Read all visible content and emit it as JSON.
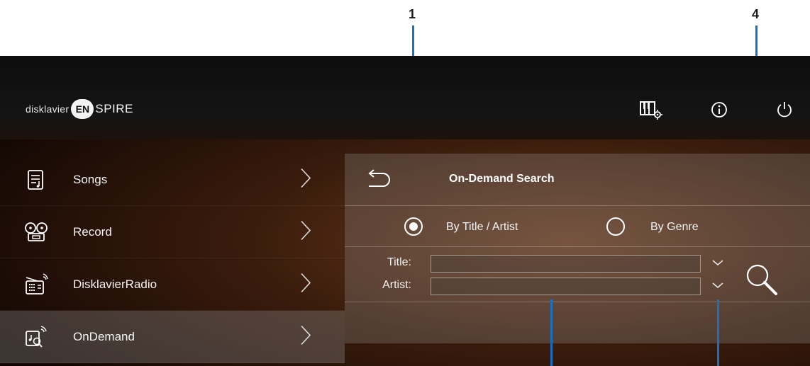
{
  "callouts": [
    "1",
    "4"
  ],
  "brand": {
    "prefix": "disklavier",
    "en": "EN",
    "suffix": "SPIRE"
  },
  "header_icons": [
    "piano-settings-icon",
    "info-icon",
    "power-icon"
  ],
  "menu": {
    "items": [
      {
        "label": "Songs",
        "icon": "songs-icon",
        "active": false
      },
      {
        "label": "Record",
        "icon": "record-icon",
        "active": false
      },
      {
        "label": "DisklavierRadio",
        "icon": "radio-icon",
        "active": false
      },
      {
        "label": "OnDemand",
        "icon": "ondemand-icon",
        "active": true
      }
    ]
  },
  "panel": {
    "title": "On-Demand Search",
    "search_mode": {
      "options": [
        "By Title / Artist",
        "By Genre"
      ],
      "selected": "By Title / Artist"
    },
    "title_field": {
      "label": "Title:",
      "value": ""
    },
    "artist_field": {
      "label": "Artist:",
      "value": ""
    }
  },
  "colors": {
    "callout_line": "#1a6fc0",
    "menu_active_bg": "#8c8c8c"
  }
}
